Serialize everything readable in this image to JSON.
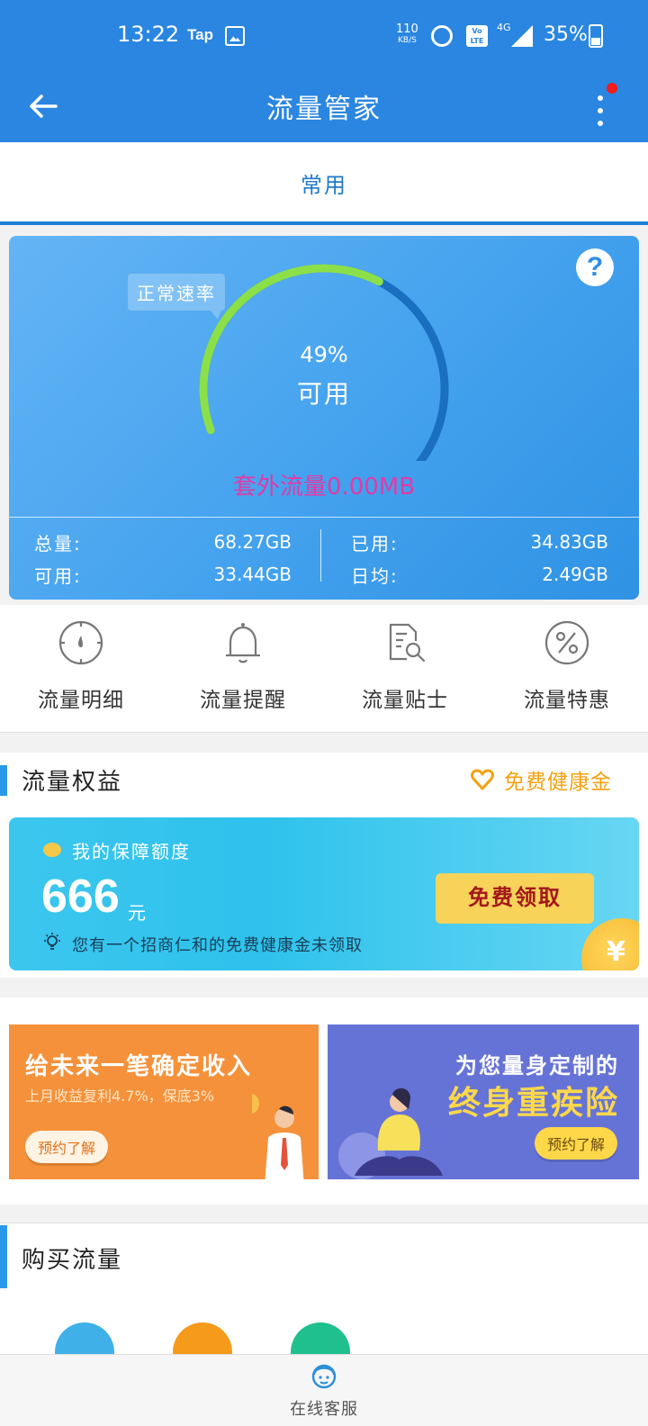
{
  "status_bar": {
    "time": "13:22",
    "app_badge": "Tap",
    "net_speed": "110",
    "net_speed_unit": "KB/S",
    "volte": "Vo LTE",
    "network": "4G",
    "battery": "35%"
  },
  "app_bar": {
    "title": "流量管家"
  },
  "tabs": [
    {
      "label": "常用",
      "active": true
    }
  ],
  "usage_card": {
    "speed_tip": "正常速率",
    "percent": "49%",
    "percent_value": 0.49,
    "available_label": "可用",
    "overflow": "套外流量0.00MB",
    "stats": [
      {
        "label": "总量:",
        "value": "68.27GB"
      },
      {
        "label": "已用:",
        "value": "34.83GB"
      },
      {
        "label": "可用:",
        "value": "33.44GB"
      },
      {
        "label": "日均:",
        "value": "2.49GB"
      }
    ],
    "colors": {
      "arc_remaining": "#8be049",
      "arc_used": "#1a6fc0",
      "overflow_text": "#e13aa6"
    }
  },
  "quick_actions": [
    {
      "label": "流量明细",
      "icon": "compass-icon"
    },
    {
      "label": "流量提醒",
      "icon": "bell-icon"
    },
    {
      "label": "流量贴士",
      "icon": "document-search-icon"
    },
    {
      "label": "流量特惠",
      "icon": "percent-icon"
    }
  ],
  "rights": {
    "title": "流量权益",
    "link": "免费健康金",
    "card": {
      "label": "我的保障额度",
      "amount": "666",
      "unit": "元",
      "note": "您有一个招商仁和的免费健康金未领取",
      "button": "免费领取",
      "coin_symbol": "¥"
    }
  },
  "promos": [
    {
      "title": "给未来一笔确定收入",
      "subtitle": "上月收益复利4.7%，保底3%",
      "button": "预约了解",
      "coin_symbol": "¥"
    },
    {
      "title": "为您量身定制的",
      "highlight": "终身重疾险",
      "button": "预约了解"
    }
  ],
  "buy": {
    "title": "购买流量"
  },
  "service": {
    "label": "在线客服"
  }
}
